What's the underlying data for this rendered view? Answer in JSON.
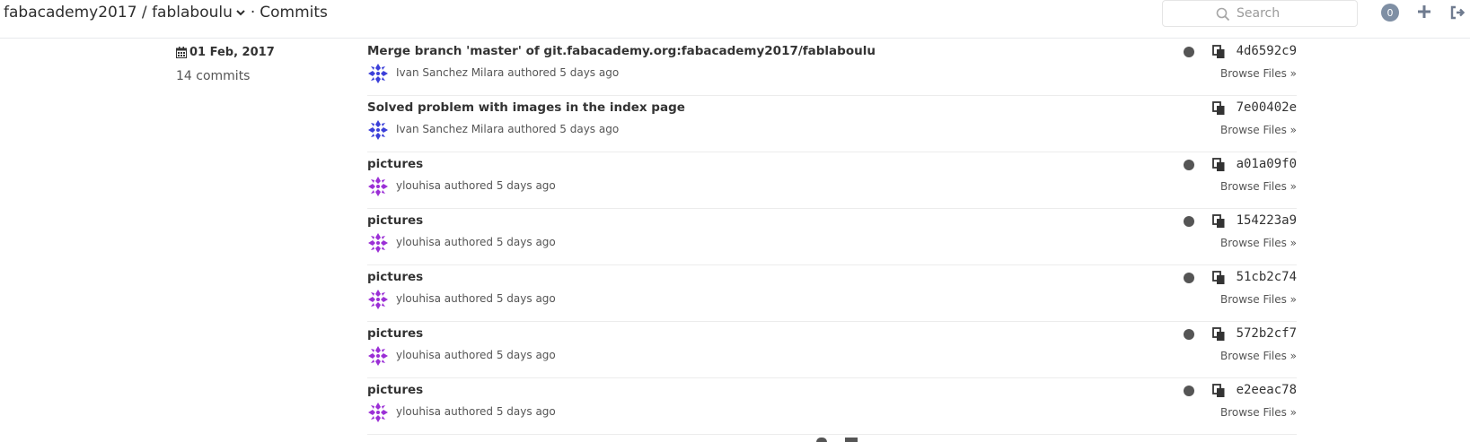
{
  "header": {
    "breadcrumb_group": "fabacademy2017",
    "breadcrumb_sep": "/",
    "breadcrumb_project": "fablaboulu",
    "breadcrumb_dot": "·",
    "breadcrumb_page": "Commits",
    "search_placeholder": "Search",
    "todo_count": "0",
    "icons": [
      "chevron-down-icon",
      "search-icon",
      "plus-icon",
      "sign-out-icon"
    ]
  },
  "day": {
    "date": "01 Feb, 2017",
    "count": "14 commits"
  },
  "commits": [
    {
      "title": "Merge branch 'master' of git.fabacademy.org:fabacademy2017/fablaboulu",
      "author": "Ivan Sanchez Milara",
      "meta": "authored 5 days ago",
      "sha": "4d6592c9",
      "browse": "Browse Files »",
      "avatar_color": "#3b3fd9",
      "status": true
    },
    {
      "title": "Solved problem with images in the index page",
      "author": "Ivan Sanchez Milara",
      "meta": "authored 5 days ago",
      "sha": "7e00402e",
      "browse": "Browse Files »",
      "avatar_color": "#3b3fd9",
      "status": false
    },
    {
      "title": "pictures",
      "author": "ylouhisa",
      "meta": "authored 5 days ago",
      "sha": "a01a09f0",
      "browse": "Browse Files »",
      "avatar_color": "#9b2fd6",
      "status": true
    },
    {
      "title": "pictures",
      "author": "ylouhisa",
      "meta": "authored 5 days ago",
      "sha": "154223a9",
      "browse": "Browse Files »",
      "avatar_color": "#9b2fd6",
      "status": true
    },
    {
      "title": "pictures",
      "author": "ylouhisa",
      "meta": "authored 5 days ago",
      "sha": "51cb2c74",
      "browse": "Browse Files »",
      "avatar_color": "#9b2fd6",
      "status": true
    },
    {
      "title": "pictures",
      "author": "ylouhisa",
      "meta": "authored 5 days ago",
      "sha": "572b2cf7",
      "browse": "Browse Files »",
      "avatar_color": "#9b2fd6",
      "status": true
    },
    {
      "title": "pictures",
      "author": "ylouhisa",
      "meta": "authored 5 days ago",
      "sha": "e2eeac78",
      "browse": "Browse Files »",
      "avatar_color": "#9b2fd6",
      "status": true
    }
  ]
}
